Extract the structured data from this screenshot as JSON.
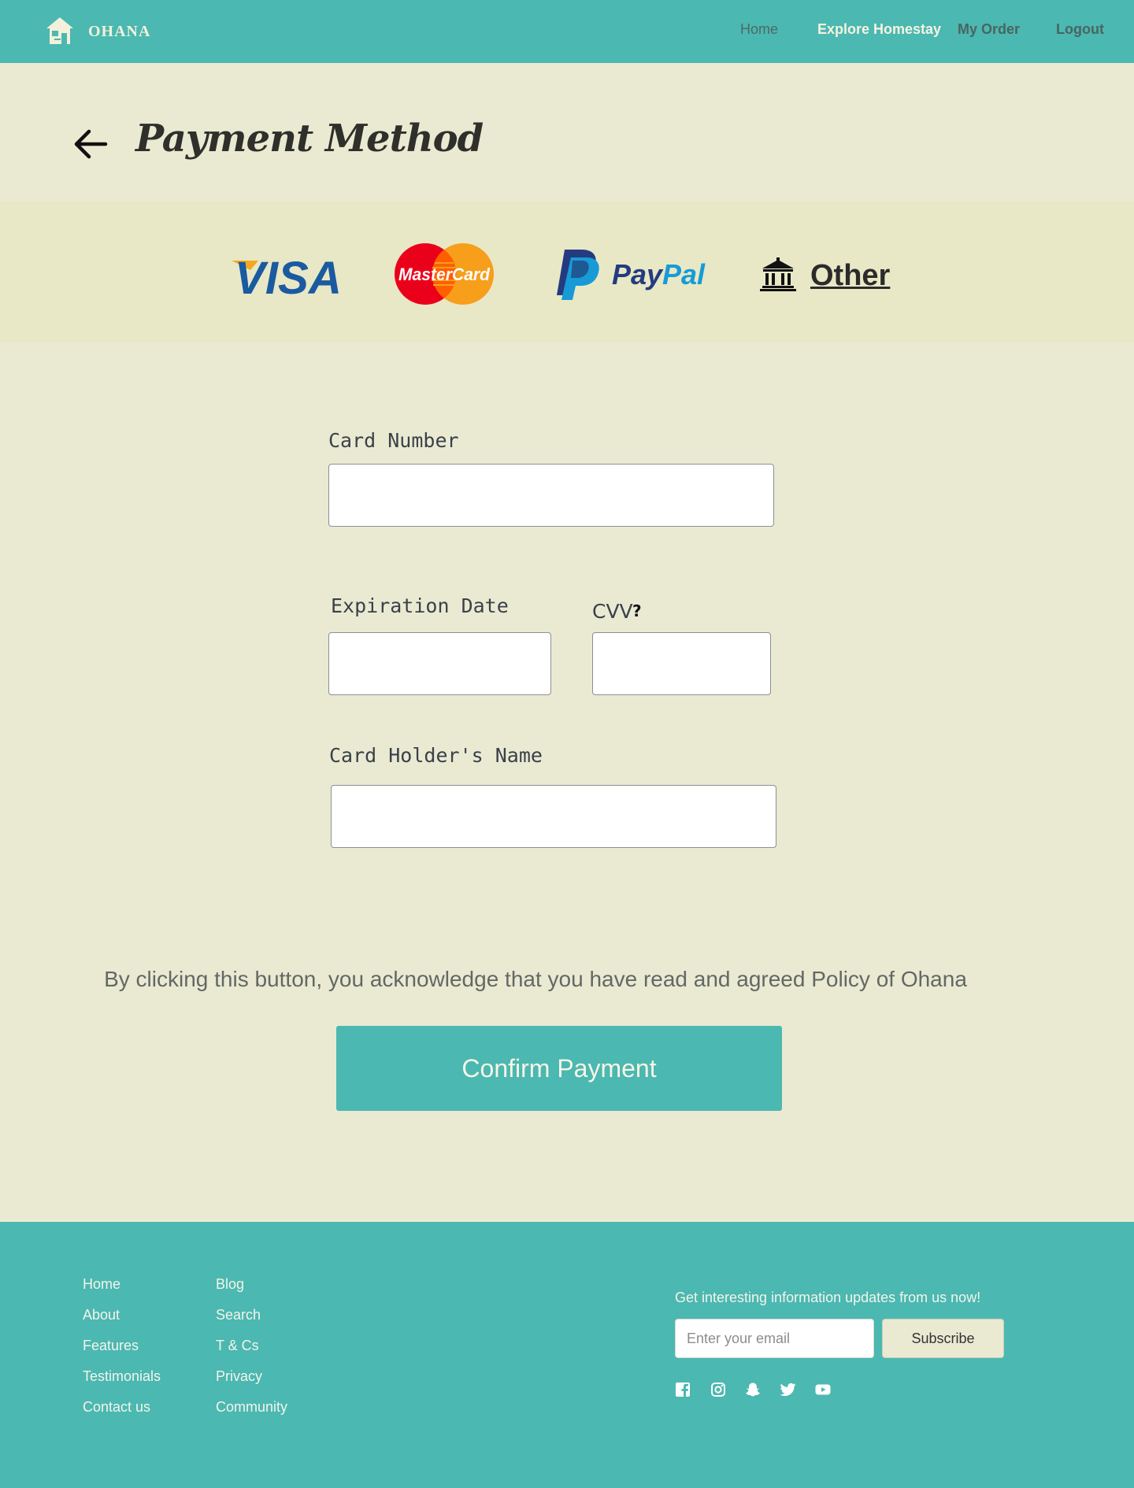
{
  "navbar": {
    "brand": "OHANA",
    "links": [
      "Home",
      "Explore Homestay",
      "My Order",
      "Logout"
    ]
  },
  "page": {
    "title": "Payment Method"
  },
  "payment_methods": {
    "visa": "VISA",
    "mastercard": "MasterCard",
    "paypal_pay": "Pay",
    "paypal_pal": "Pal",
    "other": "Other"
  },
  "form": {
    "card_number_label": "Card Number",
    "card_number_value": "",
    "expiration_label": "Expiration Date",
    "expiration_value": "",
    "cvv_label": "CVV",
    "cvv_help": "?",
    "cvv_value": "",
    "holder_label": "Card Holder's Name",
    "holder_value": ""
  },
  "agreement": "By clicking this button, you acknowledge that you have read and agreed Policy of Ohana",
  "confirm_label": "Confirm Payment",
  "footer": {
    "col1": [
      "Home",
      "About",
      "Features",
      "Testimonials",
      "Contact us"
    ],
    "col2": [
      "Blog",
      "Search",
      "T & Cs",
      "Privacy",
      "Community"
    ],
    "newsletter_text": "Get interesting information updates from us now!",
    "email_placeholder": "Enter your email",
    "subscribe_label": "Subscribe",
    "social_icons": [
      "facebook-icon",
      "instagram-icon",
      "snapchat-icon",
      "twitter-icon",
      "youtube-icon"
    ]
  },
  "colors": {
    "primary": "#4bb8b1",
    "background": "#eaead3",
    "band": "#e8e8c6"
  }
}
